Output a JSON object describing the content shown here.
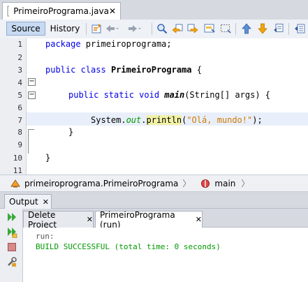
{
  "file_tab": {
    "name": "PrimeiroPrograma.java",
    "close": "✕"
  },
  "toolbar": {
    "source_label": "Source",
    "history_label": "History"
  },
  "editor": {
    "line_numbers": [
      "1",
      "2",
      "3",
      "4",
      "5",
      "6",
      "7",
      "8",
      "9",
      "10",
      "11"
    ],
    "fold_markers": [
      "−",
      "−"
    ],
    "line1": {
      "kw": "package",
      "rest": " primeiroprograma;"
    },
    "line3": {
      "kw": "public class",
      "name": "PrimeiroPrograma",
      "rest": " {"
    },
    "line5": {
      "kw": "public static void",
      "method": "main",
      "rest": "(String[] args) {"
    },
    "line7": {
      "a": "System.",
      "field": "out",
      "b": ".",
      "call": "println",
      "c": "(",
      "str": "\"Olá, mundo!\"",
      "d": ");"
    },
    "line8": "}",
    "line10": "}"
  },
  "breadcrumb": {
    "class_name": "primeiroprograma.PrimeiroPrograma",
    "method_name": "main",
    "separator": "〉"
  },
  "output": {
    "title": "Output",
    "close": "✕",
    "tabs": [
      {
        "label": "Delete Project",
        "close": "✕"
      },
      {
        "label": "PrimeiroPrograma (run)",
        "close": "✕"
      }
    ],
    "lines": [
      "run:",
      "BUILD SUCCESSFUL (total time: 0 seconds)"
    ]
  },
  "colors": {
    "keyword": "#0000e6",
    "string": "#ce7b00",
    "field": "#009900",
    "build_success": "#009900"
  },
  "icons": [
    "java-file-icon",
    "last-edit-icon",
    "back-icon",
    "forward-icon",
    "find-icon",
    "find-previous-icon",
    "find-next-icon",
    "toggle-highlight-icon",
    "toggle-rect-selection-icon",
    "previous-bookmark-icon",
    "next-bookmark-icon",
    "toggle-bookmark-icon",
    "shift-left-icon",
    "class-icon",
    "method-icon",
    "rerun-icon",
    "rerun-different-params-icon",
    "stop-icon",
    "settings-icon"
  ]
}
